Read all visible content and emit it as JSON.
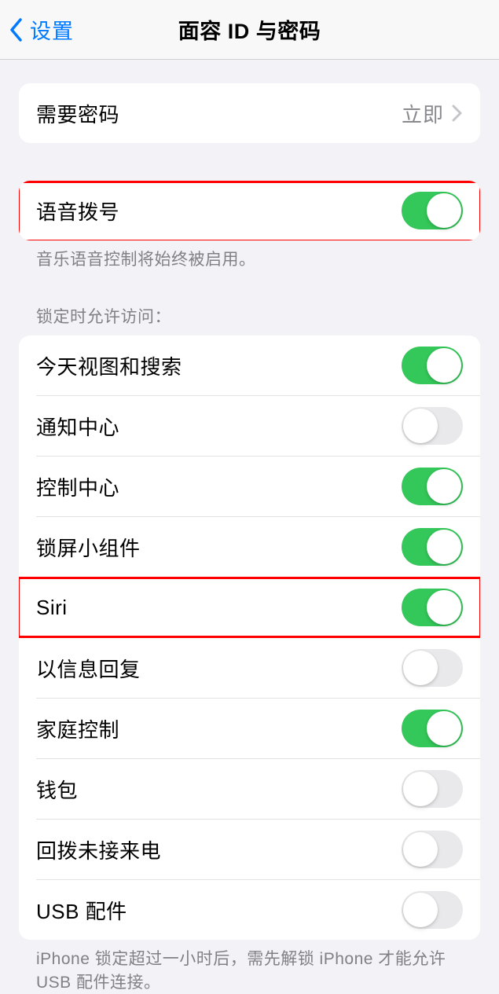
{
  "header": {
    "back_label": "设置",
    "title": "面容 ID 与密码"
  },
  "require_passcode": {
    "label": "需要密码",
    "value": "立即"
  },
  "voice_dial": {
    "label": "语音拨号",
    "on": true,
    "footer": "音乐语音控制将始终被启用。"
  },
  "lock_access": {
    "header": "锁定时允许访问：",
    "items": [
      {
        "label": "今天视图和搜索",
        "on": true
      },
      {
        "label": "通知中心",
        "on": false
      },
      {
        "label": "控制中心",
        "on": true
      },
      {
        "label": "锁屏小组件",
        "on": true
      },
      {
        "label": "Siri",
        "on": true,
        "highlight": true
      },
      {
        "label": "以信息回复",
        "on": false
      },
      {
        "label": "家庭控制",
        "on": true
      },
      {
        "label": "钱包",
        "on": false
      },
      {
        "label": "回拨未接来电",
        "on": false
      },
      {
        "label": "USB 配件",
        "on": false
      }
    ],
    "footer": "iPhone 锁定超过一小时后，需先解锁 iPhone 才能允许USB 配件连接。"
  }
}
